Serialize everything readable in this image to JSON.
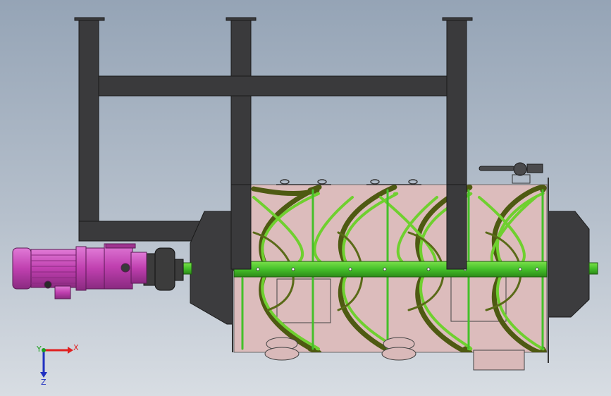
{
  "viewport": {
    "name": "cad-viewport"
  },
  "triad": {
    "x_label": "X",
    "y_label": "Y",
    "z_label": "Z"
  },
  "colors": {
    "frame": "#3a3a3c",
    "frame_edge": "#1a1a1a",
    "trough": "#d9b9b9",
    "shaft": "#45c02a",
    "ribbon_light": "#6fd02f",
    "ribbon_dark": "#4e5a12",
    "motor": "#c040b0",
    "coupling": "#3c3c3c",
    "axis_x": "#e02020",
    "axis_y": "#20a020",
    "axis_z": "#2030c0"
  },
  "icons": [
    "coordinate-triad-icon"
  ]
}
